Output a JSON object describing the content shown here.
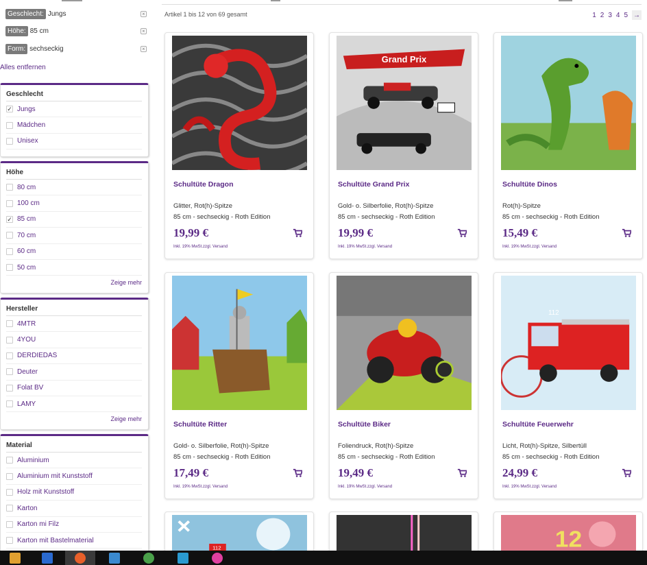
{
  "active_filters": [
    {
      "label": "Geschlecht:",
      "value": "Jungs"
    },
    {
      "label": "Höhe:",
      "value": "85 cm"
    },
    {
      "label": "Form:",
      "value": "sechseckig"
    }
  ],
  "remove_all": "Alles entfernen",
  "filters": {
    "geschlecht": {
      "title": "Geschlecht",
      "items": [
        {
          "label": "Jungs",
          "checked": true
        },
        {
          "label": "Mädchen",
          "checked": false
        },
        {
          "label": "Unisex",
          "checked": false
        }
      ]
    },
    "hoehe": {
      "title": "Höhe",
      "more": "Zeige mehr",
      "items": [
        {
          "label": "80 cm",
          "checked": false
        },
        {
          "label": "100 cm",
          "checked": false
        },
        {
          "label": "85 cm",
          "checked": true
        },
        {
          "label": "70 cm",
          "checked": false
        },
        {
          "label": "60 cm",
          "checked": false
        },
        {
          "label": "50 cm",
          "checked": false
        }
      ]
    },
    "hersteller": {
      "title": "Hersteller",
      "more": "Zeige mehr",
      "items": [
        {
          "label": "4MTR",
          "checked": false
        },
        {
          "label": "4YOU",
          "checked": false
        },
        {
          "label": "DERDIEDAS",
          "checked": false
        },
        {
          "label": "Deuter",
          "checked": false
        },
        {
          "label": "Folat BV",
          "checked": false
        },
        {
          "label": "LAMY",
          "checked": false
        }
      ]
    },
    "material": {
      "title": "Material",
      "items": [
        {
          "label": "Aluminium",
          "checked": false
        },
        {
          "label": "Aluminium mit Kunststoff",
          "checked": false
        },
        {
          "label": "Holz mit Kunststoff",
          "checked": false
        },
        {
          "label": "Karton",
          "checked": false
        },
        {
          "label": "Karton mi Filz",
          "checked": false
        },
        {
          "label": "Karton mit Bastelmaterial",
          "checked": false
        }
      ]
    }
  },
  "listing": {
    "count_text": "Artikel 1 bis 12 von 69 gesamt",
    "pages": [
      "1",
      "2",
      "3",
      "4",
      "5"
    ],
    "next": "→"
  },
  "vat_text": "Inkl. 19% MwSt.zzgl. Versand",
  "products": [
    {
      "title": "Schultüte Dragon",
      "desc1": "Glitter, Rot(h)-Spitze",
      "desc2": "85 cm - sechseckig - Roth Edition",
      "price": "19,99 €",
      "image": "red-dragon"
    },
    {
      "title": "Schultüte Grand Prix",
      "desc1": "Gold- o. Silberfolie, Rot(h)-Spitze",
      "desc2": "85 cm - sechseckig - Roth Edition",
      "price": "19,99 €",
      "image": "race-cars",
      "banner": "Grand Prix"
    },
    {
      "title": "Schultüte Dinos",
      "desc1": "Rot(h)-Spitze",
      "desc2": "85 cm - sechseckig - Roth Edition",
      "price": "15,49 €",
      "image": "dinosaurs"
    },
    {
      "title": "Schultüte Ritter",
      "desc1": "Gold- o. Silberfolie, Rot(h)-Spitze",
      "desc2": "85 cm - sechseckig - Roth Edition",
      "price": "17,49 €",
      "image": "knight"
    },
    {
      "title": "Schultüte Biker",
      "desc1": "Foliendruck, Rot(h)-Spitze",
      "desc2": "85 cm - sechseckig - Roth Edition",
      "price": "19,49 €",
      "image": "motorbike"
    },
    {
      "title": "Schultüte Feuerwehr",
      "desc1": "Licht, Rot(h)-Spitze, Silbertüll",
      "desc2": "85 cm - sechseckig - Roth Edition",
      "price": "24,99 €",
      "image": "fire-truck",
      "truck_number": "112"
    }
  ],
  "partial_products": [
    {
      "image": "fire-truck-2",
      "truck_number": "112"
    },
    {
      "image": "lightsaber"
    },
    {
      "image": "numbers"
    }
  ],
  "colors": {
    "accent": "#5b2a86",
    "chip": "#7a7a7a",
    "taskbar": "#101010"
  },
  "taskbar": [
    "folder-icon",
    "store-icon",
    "firefox-icon",
    "window-icon",
    "globe-icon",
    "app-icon",
    "paint-icon"
  ]
}
